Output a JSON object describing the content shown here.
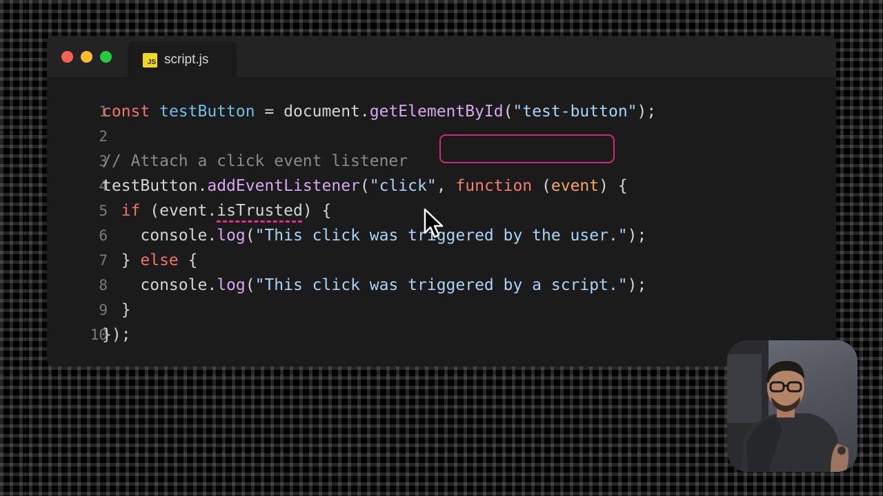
{
  "window": {
    "controls": [
      "close",
      "minimize",
      "maximize"
    ],
    "tab": {
      "icon": "JS",
      "label": "script.js"
    }
  },
  "code": {
    "lines": [
      {
        "num": "1",
        "tokens": [
          {
            "t": "const ",
            "c": "kw"
          },
          {
            "t": "testButton",
            "c": "vr"
          },
          {
            "t": " = ",
            "c": "pl"
          },
          {
            "t": "document",
            "c": "pl"
          },
          {
            "t": ".",
            "c": "pl"
          },
          {
            "t": "getElementById",
            "c": "fn"
          },
          {
            "t": "(",
            "c": "pl"
          },
          {
            "t": "\"test-button\"",
            "c": "st"
          },
          {
            "t": ");",
            "c": "pl"
          }
        ]
      },
      {
        "num": "2",
        "tokens": []
      },
      {
        "num": "3",
        "tokens": [
          {
            "t": "// Attach a click event listener",
            "c": "cm"
          }
        ]
      },
      {
        "num": "4",
        "tokens": [
          {
            "t": "testButton",
            "c": "pl"
          },
          {
            "t": ".",
            "c": "pl"
          },
          {
            "t": "addEventListener",
            "c": "fn"
          },
          {
            "t": "(",
            "c": "pl"
          },
          {
            "t": "\"click\"",
            "c": "st"
          },
          {
            "t": ", ",
            "c": "pl"
          },
          {
            "t": "function",
            "c": "fk"
          },
          {
            "t": " (",
            "c": "pl"
          },
          {
            "t": "event",
            "c": "pm"
          },
          {
            "t": ") {",
            "c": "pl"
          }
        ]
      },
      {
        "num": "5",
        "tokens": [
          {
            "t": "  ",
            "c": "pl"
          },
          {
            "t": "if",
            "c": "kw"
          },
          {
            "t": " (",
            "c": "pl"
          },
          {
            "t": "event",
            "c": "pl"
          },
          {
            "t": ".",
            "c": "pl"
          },
          {
            "t": "isTrusted",
            "c": "pl squig"
          },
          {
            "t": ") {",
            "c": "pl"
          }
        ]
      },
      {
        "num": "6",
        "tokens": [
          {
            "t": "    ",
            "c": "pl"
          },
          {
            "t": "console",
            "c": "pl"
          },
          {
            "t": ".",
            "c": "pl"
          },
          {
            "t": "log",
            "c": "fn"
          },
          {
            "t": "(",
            "c": "pl"
          },
          {
            "t": "\"This click was triggered by the user.\"",
            "c": "st"
          },
          {
            "t": ");",
            "c": "pl"
          }
        ]
      },
      {
        "num": "7",
        "tokens": [
          {
            "t": "  } ",
            "c": "pl"
          },
          {
            "t": "else",
            "c": "kw"
          },
          {
            "t": " {",
            "c": "pl"
          }
        ]
      },
      {
        "num": "8",
        "tokens": [
          {
            "t": "    ",
            "c": "pl"
          },
          {
            "t": "console",
            "c": "pl"
          },
          {
            "t": ".",
            "c": "pl"
          },
          {
            "t": "log",
            "c": "fn"
          },
          {
            "t": "(",
            "c": "pl"
          },
          {
            "t": "\"This click was triggered by a script.\"",
            "c": "st"
          },
          {
            "t": ");",
            "c": "pl"
          }
        ]
      },
      {
        "num": "9",
        "tokens": [
          {
            "t": "  }",
            "c": "pl"
          }
        ]
      },
      {
        "num": "10",
        "tokens": [
          {
            "t": "});",
            "c": "pl"
          }
        ]
      }
    ]
  },
  "highlight": {
    "target": "function (event)",
    "color": "#d6287e"
  },
  "colors": {
    "keyword": "#f0736c",
    "variable": "#6cc0e8",
    "function": "#d6a8f0",
    "string": "#a8d4f8",
    "comment": "#8a8a8a",
    "param": "#f2a66a",
    "squiggle": "#e2308a"
  },
  "overlay": {
    "webcam": "presenter-webcam",
    "pointer": "mouse-cursor-icon"
  }
}
